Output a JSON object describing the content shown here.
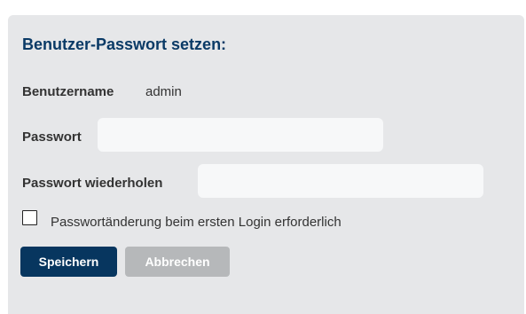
{
  "form": {
    "title": "Benutzer-Passwort setzen:",
    "username_label": "Benutzername",
    "username_value": "admin",
    "password_label": "Passwort",
    "password_value": "",
    "password_repeat_label": "Passwort wiederholen",
    "password_repeat_value": "",
    "require_change_label": "Passwortänderung beim ersten Login erforderlich",
    "require_change_checked": false
  },
  "actions": {
    "save_label": "Speichern",
    "cancel_label": "Abbrechen"
  },
  "colors": {
    "panel_background": "#e6e7e9",
    "title": "#0a3a66",
    "primary_button": "#07365f",
    "secondary_button": "#b6b8ba",
    "input_background": "#f7f8f9"
  }
}
